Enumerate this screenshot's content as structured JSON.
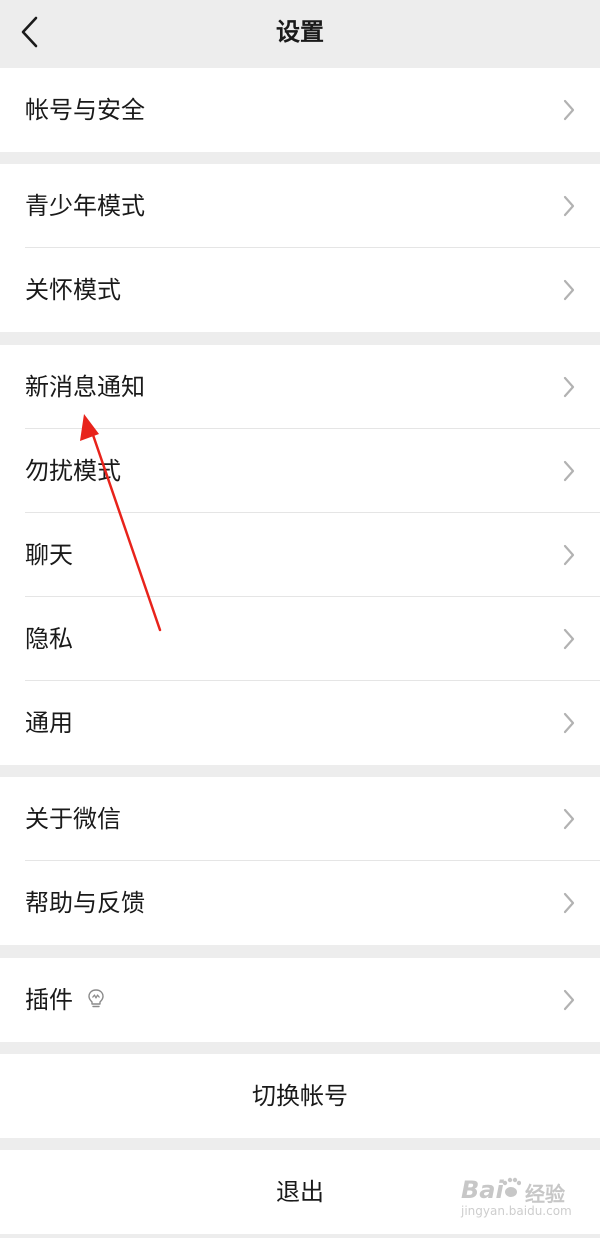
{
  "header": {
    "title": "设置"
  },
  "groups": [
    {
      "items": [
        "帐号与安全"
      ]
    },
    {
      "items": [
        "青少年模式",
        "关怀模式"
      ]
    },
    {
      "items": [
        "新消息通知",
        "勿扰模式",
        "聊天",
        "隐私",
        "通用"
      ]
    },
    {
      "items": [
        "关于微信",
        "帮助与反馈"
      ]
    },
    {
      "items": [
        "插件"
      ]
    }
  ],
  "actions": {
    "switch_account": "切换帐号",
    "logout": "退出"
  },
  "watermark": {
    "brand_suffix": "经验",
    "url": "jingyan.baidu.com"
  },
  "colors": {
    "background": "#ededed",
    "card": "#ffffff",
    "annotation_arrow": "#e8231b"
  },
  "icons": {
    "back": "back-arrow-icon",
    "row_chevron": "chevron-right-icon",
    "plugin_badge": "lightbulb-icon"
  }
}
